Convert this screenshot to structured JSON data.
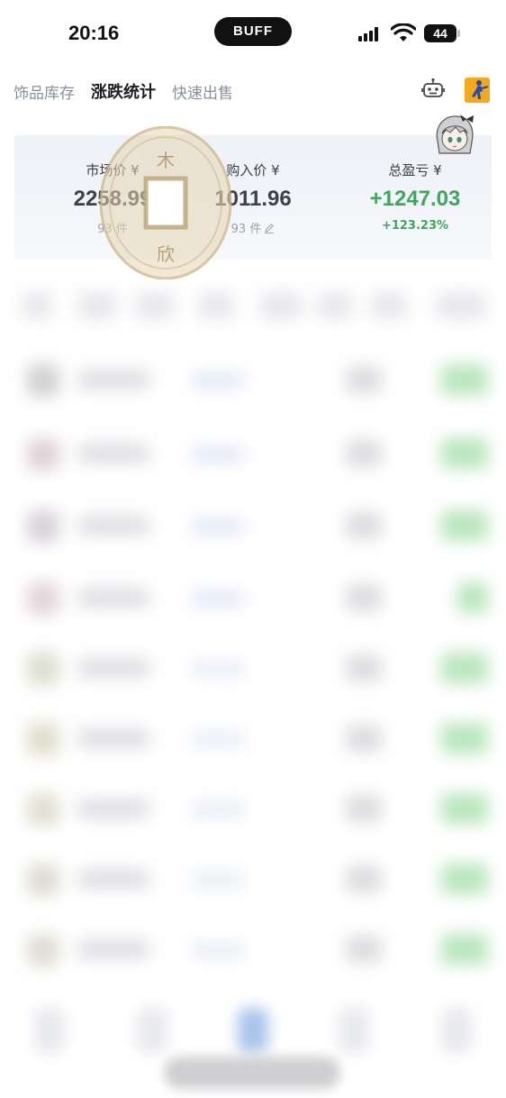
{
  "status_bar": {
    "time": "20:16",
    "island_text": "BUFF",
    "battery_level": "44",
    "signal_icon": "signal-bars-icon",
    "wifi_icon": "wifi-icon"
  },
  "tabs": [
    {
      "label": "饰品库存",
      "active": false
    },
    {
      "label": "涨跌统计",
      "active": true
    },
    {
      "label": "快速出售",
      "active": false
    }
  ],
  "header_icons": [
    "robot-icon",
    "game-logo-icon"
  ],
  "summary": {
    "market_price": {
      "label": "市场价 ¥",
      "value": "2258.99",
      "sub": "93 件"
    },
    "purchase_price": {
      "label": "购入价 ¥",
      "value": "1011.96",
      "sub": "93 件"
    },
    "total_pnl": {
      "label": "总盈亏 ¥",
      "value": "+1247.03",
      "sub": "+123.23%"
    }
  },
  "watermark": {
    "chars": [
      "木",
      "欣"
    ]
  },
  "colors": {
    "gain": "#3ba85a",
    "accent": "#f3a91a",
    "text_primary": "#1d1f24",
    "text_secondary": "#8a8f99"
  }
}
